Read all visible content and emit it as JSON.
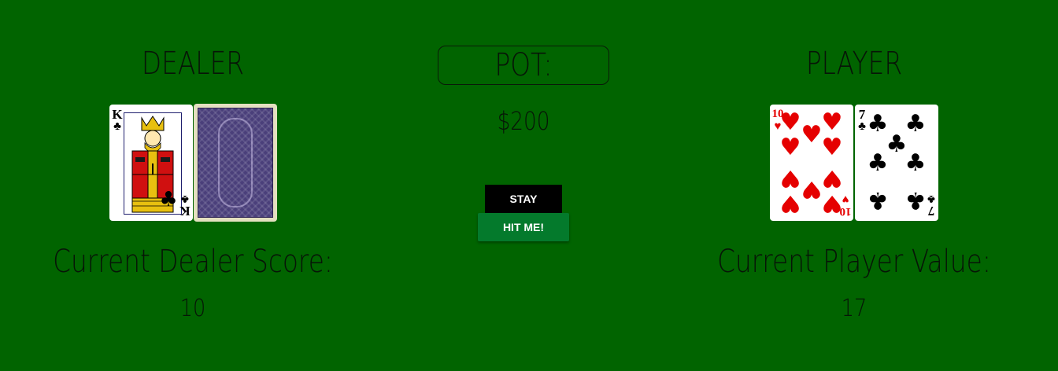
{
  "dealer": {
    "title": "DEALER",
    "cards": [
      {
        "rank": "K",
        "suit": "♣",
        "suit_name": "clubs",
        "face_up": true
      },
      {
        "face_up": false
      }
    ],
    "score_label": "Current Dealer Score:",
    "score": "10"
  },
  "pot": {
    "label": "POT:",
    "amount": "$200"
  },
  "controls": {
    "stay_label": "STAY",
    "hit_label": "HIT ME!"
  },
  "player": {
    "title": "PLAYER",
    "cards": [
      {
        "rank": "10",
        "suit": "♥",
        "suit_name": "hearts",
        "face_up": true
      },
      {
        "rank": "7",
        "suit": "♣",
        "suit_name": "clubs",
        "face_up": true
      }
    ],
    "score_label": "Current Player Value:",
    "score": "17"
  },
  "colors": {
    "table_felt": "#016400",
    "hit_button": "#047a2c",
    "stay_button": "#000000",
    "card_back": "#4a3f7a",
    "red_suit": "#e50000"
  }
}
